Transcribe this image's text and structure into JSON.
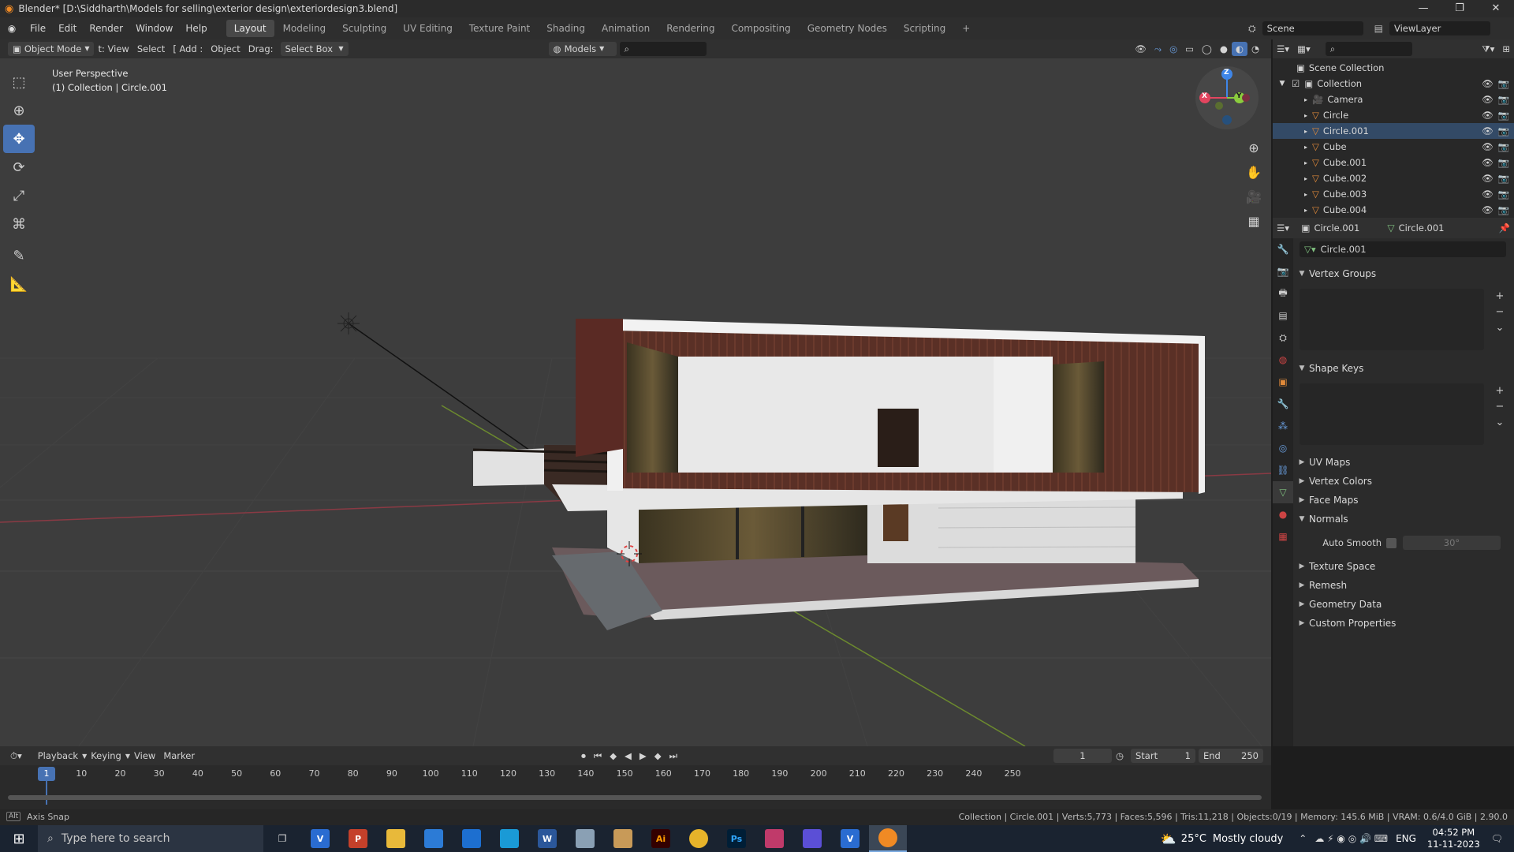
{
  "titlebar": {
    "title": "Blender* [D:\\Siddharth\\Models for selling\\exterior design\\exteriordesign3.blend]",
    "minimize": "—",
    "maximize": "❐",
    "close": "✕"
  },
  "menu": [
    "File",
    "Edit",
    "Render",
    "Window",
    "Help"
  ],
  "workspaces": [
    {
      "label": "Layout",
      "active": true
    },
    {
      "label": "Modeling"
    },
    {
      "label": "Sculpting"
    },
    {
      "label": "UV Editing"
    },
    {
      "label": "Texture Paint"
    },
    {
      "label": "Shading"
    },
    {
      "label": "Animation"
    },
    {
      "label": "Rendering"
    },
    {
      "label": "Compositing"
    },
    {
      "label": "Geometry Nodes"
    },
    {
      "label": "Scripting"
    }
  ],
  "add_workspace": "+",
  "scene": {
    "label": "Scene",
    "viewlayer": "ViewLayer"
  },
  "viewport_header": {
    "mode": "Object Mode",
    "view": "t: View",
    "select": "Select",
    "add": "[ Add :",
    "object": "Object",
    "drag_label": "Drag:",
    "drag_value": "Select Box",
    "models": "Models"
  },
  "viewport": {
    "perspective": "User Perspective",
    "collection": "(1) Collection | Circle.001",
    "gizmo": {
      "z": "Z",
      "y": "Y",
      "x": "X"
    }
  },
  "tools": [
    "select-box",
    "cursor",
    "move",
    "rotate",
    "scale",
    "transform",
    "annotate",
    "measure"
  ],
  "outliner": {
    "root": "Scene Collection",
    "collection": "Collection",
    "items": [
      "Camera",
      "Circle",
      "Circle.001",
      "Cube",
      "Cube.001",
      "Cube.002",
      "Cube.003",
      "Cube.004"
    ]
  },
  "properties": {
    "object_name": "Circle.001",
    "data_name": "Circle.001",
    "mesh_name": "Circle.001",
    "panels": {
      "vertex_groups": "Vertex Groups",
      "shape_keys": "Shape Keys",
      "uv_maps": "UV Maps",
      "vertex_colors": "Vertex Colors",
      "face_maps": "Face Maps",
      "normals": "Normals",
      "auto_smooth": "Auto Smooth",
      "angle": "30°",
      "texture_space": "Texture Space",
      "remesh": "Remesh",
      "geometry_data": "Geometry Data",
      "custom_properties": "Custom Properties"
    }
  },
  "timeline": {
    "playback": "Playback",
    "keying": "Keying",
    "view": "View",
    "marker": "Marker",
    "current_frame": "1",
    "start_label": "Start",
    "start": "1",
    "end_label": "End",
    "end": "250",
    "ruler": [
      "1",
      "10",
      "20",
      "30",
      "40",
      "50",
      "60",
      "70",
      "80",
      "90",
      "100",
      "110",
      "120",
      "130",
      "140",
      "150",
      "160",
      "170",
      "180",
      "190",
      "200",
      "210",
      "220",
      "230",
      "240",
      "250"
    ]
  },
  "statusbar": {
    "left": "Axis Snap",
    "right": "Collection | Circle.001 | Verts:5,773 | Faces:5,596 | Tris:11,218 | Objects:0/19 | Memory: 145.6 MiB | VRAM: 0.6/4.0 GiB | 2.90.0"
  },
  "taskbar": {
    "search_placeholder": "Type here to search",
    "weather_temp": "25°C",
    "weather_text": "Mostly cloudy",
    "lang": "ENG",
    "time": "04:52 PM",
    "date": "11-11-2023",
    "apps": [
      "V",
      "P",
      "Ai",
      "Ps",
      "W"
    ]
  },
  "colors": {
    "accent": "#4772b3",
    "x_axis": "#e3455f",
    "y_axis": "#8bcc3e",
    "z_axis": "#3f86e8"
  }
}
